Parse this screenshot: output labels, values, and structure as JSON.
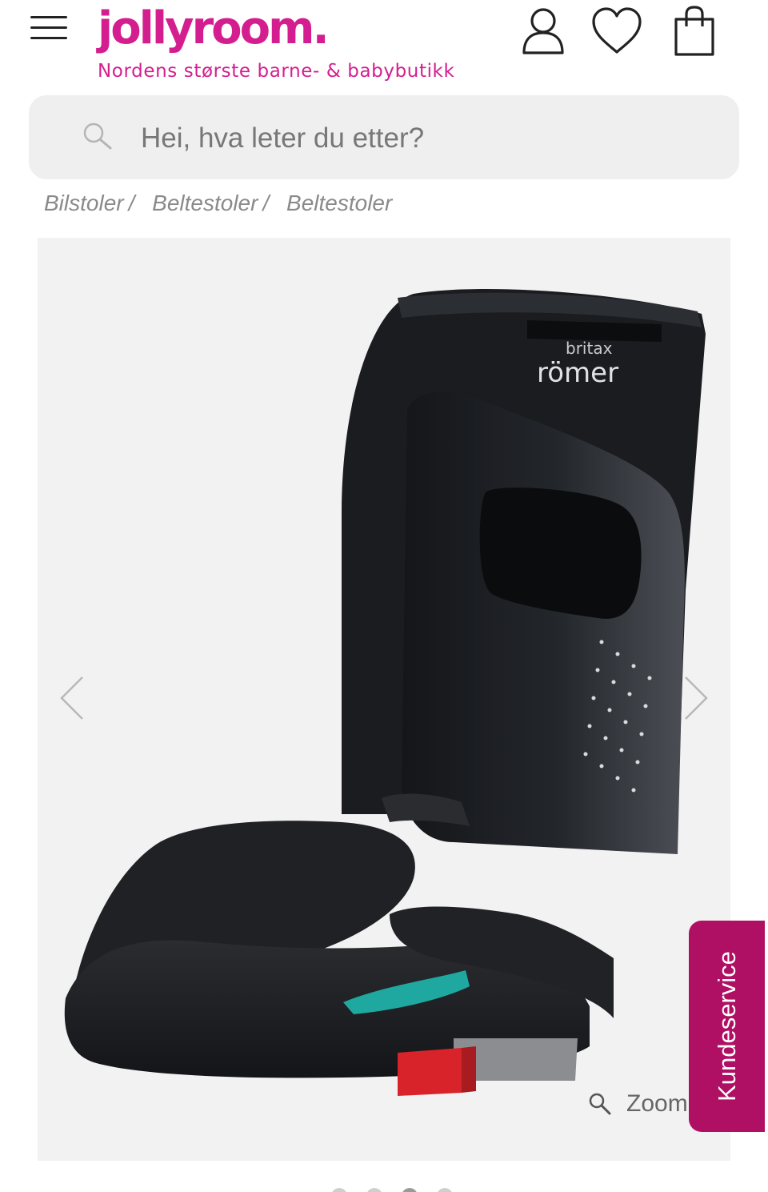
{
  "header": {
    "logo": "jollyroom.",
    "tagline": "Nordens største barne- & babybutikk",
    "brand_color": "#d41e8f",
    "icons": [
      "menu-icon",
      "account-icon",
      "heart-icon",
      "cart-bag-icon"
    ]
  },
  "search": {
    "placeholder": "Hei, hva leter du etter?"
  },
  "breadcrumb": {
    "items": [
      "Bilstoler",
      "Beltestoler",
      "Beltestoler"
    ],
    "separator": "/"
  },
  "gallery": {
    "product_logo_line1": "britax",
    "product_logo_line2": "römer",
    "zoom_label": "Zoom",
    "slide_count": 4,
    "active_slide": 3
  },
  "support": {
    "label": "Kundeservice",
    "color": "#b01063"
  }
}
